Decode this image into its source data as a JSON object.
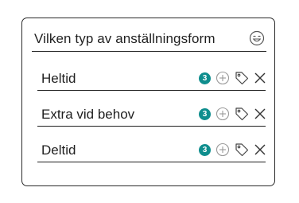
{
  "question": {
    "title": "Vilken typ av anställningsform",
    "emoji_icon": "emoji-icon"
  },
  "options": [
    {
      "label": "Heltid",
      "count": "3"
    },
    {
      "label": "Extra vid behov",
      "count": "3"
    },
    {
      "label": "Deltid",
      "count": "3"
    }
  ],
  "icons": {
    "add": "add-circle-icon",
    "tag": "tag-icon",
    "remove": "close-icon"
  },
  "colors": {
    "badge": "#0f8e8e",
    "icon_stroke": "#9a9a9a",
    "text": "#1f1f1f"
  }
}
